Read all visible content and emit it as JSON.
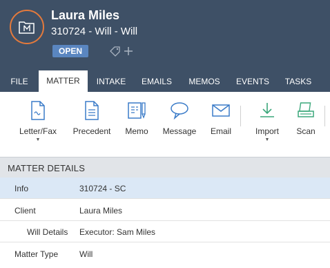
{
  "header": {
    "title": "Laura Miles",
    "subtitle": "310724 - Will - Will",
    "status": "OPEN"
  },
  "tabs": [
    {
      "label": "FILE"
    },
    {
      "label": "MATTER",
      "active": true
    },
    {
      "label": "INTAKE"
    },
    {
      "label": "EMAILS"
    },
    {
      "label": "MEMOS"
    },
    {
      "label": "EVENTS"
    },
    {
      "label": "TASKS"
    }
  ],
  "ribbon": {
    "letter_fax": "Letter/Fax",
    "precedent": "Precedent",
    "memo": "Memo",
    "message": "Message",
    "email": "Email",
    "import": "Import",
    "scan": "Scan"
  },
  "section": {
    "title": "MATTER DETAILS"
  },
  "details": [
    {
      "label": "Info",
      "value": "310724 - SC"
    },
    {
      "label": "Client",
      "value": "Laura Miles"
    },
    {
      "label": "Will Details",
      "value": "Executor: Sam Miles"
    },
    {
      "label": "Matter Type",
      "value": "Will"
    }
  ],
  "colors": {
    "header_bg": "#3e5066",
    "accent_orange": "#e47a3c",
    "badge_blue": "#5a86c0",
    "selected_row": "#dbe8f6"
  }
}
